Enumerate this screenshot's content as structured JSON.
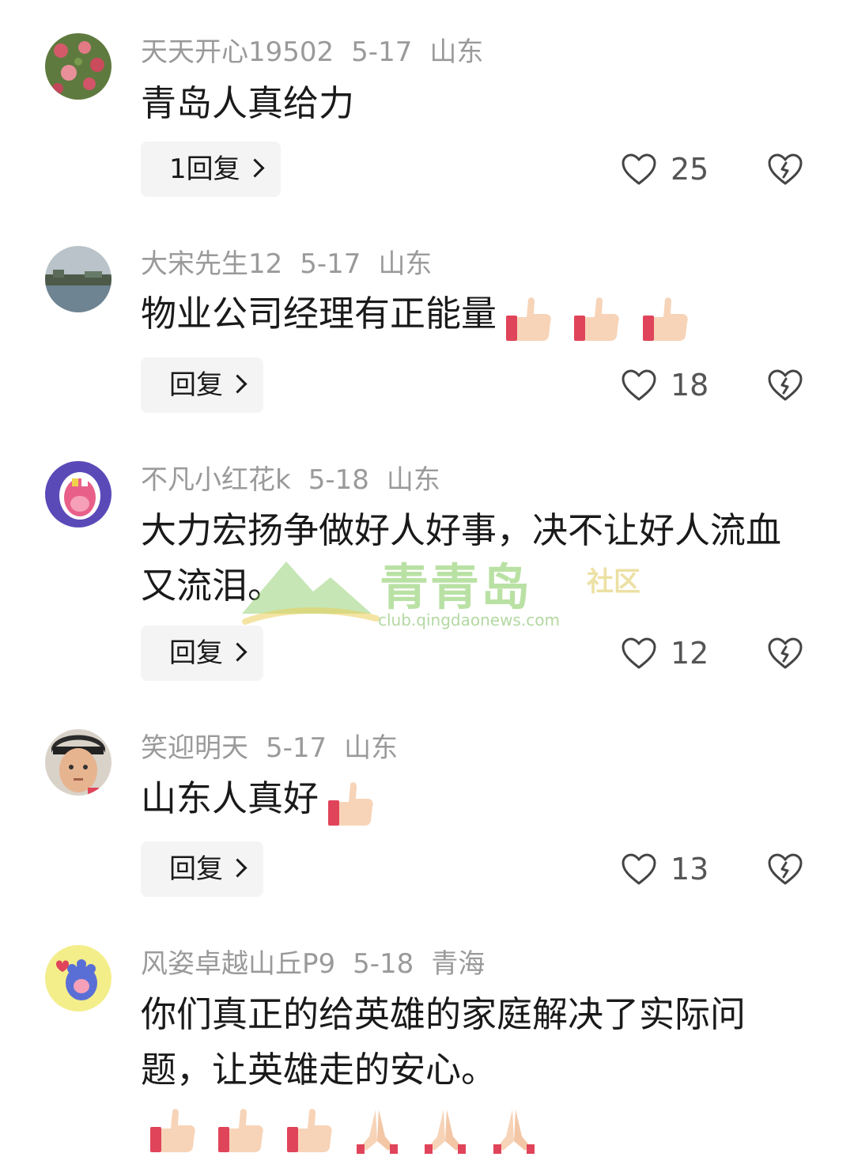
{
  "comments": [
    {
      "username": "天天开心19502",
      "date": "5-17",
      "location": "山东",
      "text": "青岛人真给力",
      "reply_label": "1回复",
      "likes": "25",
      "emojis": []
    },
    {
      "username": "大宋先生12",
      "date": "5-17",
      "location": "山东",
      "text": "物业公司经理有正能量",
      "reply_label": "回复",
      "likes": "18",
      "emojis": [
        "thumbs-up",
        "thumbs-up",
        "thumbs-up"
      ]
    },
    {
      "username": "不凡小红花k",
      "date": "5-18",
      "location": "山东",
      "text": "大力宏扬争做好人好事，决不让好人流血又流泪。",
      "reply_label": "回复",
      "likes": "12",
      "emojis": []
    },
    {
      "username": "笑迎明天",
      "date": "5-17",
      "location": "山东",
      "text": "山东人真好",
      "reply_label": "回复",
      "likes": "13",
      "emojis": [
        "thumbs-up"
      ]
    },
    {
      "username": "风姿卓越山丘P9",
      "date": "5-18",
      "location": "青海",
      "text": "你们真正的给英雄的家庭解决了实际问题，让英雄走的安心。",
      "reply_label": "",
      "likes": "",
      "emojis": [
        "thumbs-up",
        "thumbs-up",
        "thumbs-up",
        "folded-hands",
        "folded-hands",
        "folded-hands"
      ]
    }
  ],
  "watermark": {
    "brand": "青青岛",
    "tag": "社区",
    "url": "club.qingdaonews.com"
  },
  "colors": {
    "meta_text": "#9a9a9a",
    "reply_bg": "#f4f4f4",
    "watermark_green": "#80c85a"
  }
}
